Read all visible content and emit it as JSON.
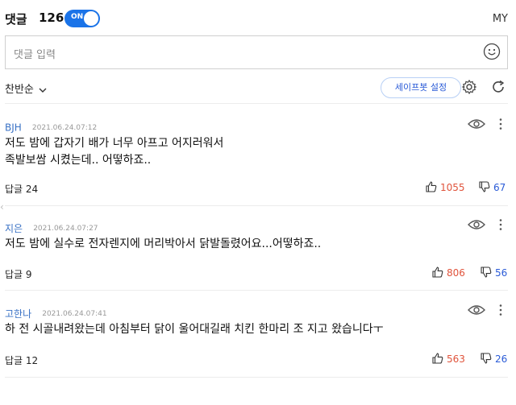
{
  "header": {
    "title": "댓글",
    "count": "126",
    "toggle_label": "ON",
    "my_label": "MY"
  },
  "input": {
    "placeholder": "댓글 입력"
  },
  "toolbar": {
    "sort_label": "찬반순",
    "safebot_label": "세이프봇 설정"
  },
  "comments": [
    {
      "author": "BJH",
      "date": "2021.06.24.07:12",
      "lines": [
        "저도 밤에 갑자기 배가 너무 아프고 어지러워서",
        "족발보쌈 시켰는데.. 어떻하죠.."
      ],
      "replies": "답글 24",
      "likes": "1055",
      "dislikes": "67"
    },
    {
      "author": "지은",
      "date": "2021.06.24.07:27",
      "lines": [
        "저도 밤에 실수로 전자렌지에 머리박아서 닭발돌렸어요...어떻하죠.."
      ],
      "replies": "답글 9",
      "likes": "806",
      "dislikes": "56"
    },
    {
      "author": "고한나",
      "date": "2021.06.24.07:41",
      "lines": [
        "하 전 시골내려왔는데 아침부터 닭이 울어대길래 치킨 한마리 조 지고 왔습니다ㅜ"
      ],
      "replies": "답글 12",
      "likes": "563",
      "dislikes": "26"
    }
  ],
  "colors": {
    "accent": "#1a73e8",
    "like": "#e0533b",
    "dislike": "#2a5bd7"
  }
}
